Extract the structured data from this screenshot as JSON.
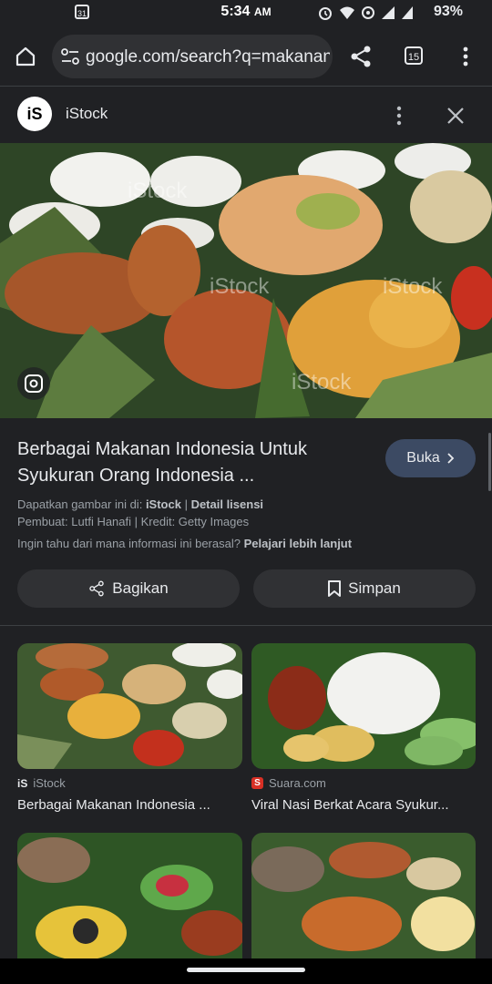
{
  "status_bar": {
    "time": "5:34",
    "ampm": "AM",
    "calendar_day": "31",
    "battery": "93%"
  },
  "browser": {
    "url": "google.com/search?q=makanan",
    "tab_count": "15"
  },
  "source": {
    "logo_text": "iS",
    "name": "iStock"
  },
  "main_image": {
    "watermark": "iStock"
  },
  "result": {
    "title": "Berbagai Makanan Indonesia Untuk Syukuran Orang Indonesia ...",
    "open_button": "Buka",
    "get_image_prefix": "Dapatkan gambar ini di:",
    "get_image_source": "iStock",
    "license_link": "Detail lisensi",
    "credit": "Pembuat: Lutfi Hanafi | Kredit: Getty Images",
    "info_question": "Ingin tahu dari mana informasi ini berasal?",
    "learn_more": "Pelajari lebih lanjut",
    "share_label": "Bagikan",
    "save_label": "Simpan"
  },
  "related": [
    {
      "source": "iStock",
      "source_icon": "iS",
      "title": "Berbagai Makanan Indonesia ..."
    },
    {
      "source": "Suara.com",
      "source_icon": "S",
      "title": "Viral Nasi Berkat Acara Syukur..."
    }
  ]
}
